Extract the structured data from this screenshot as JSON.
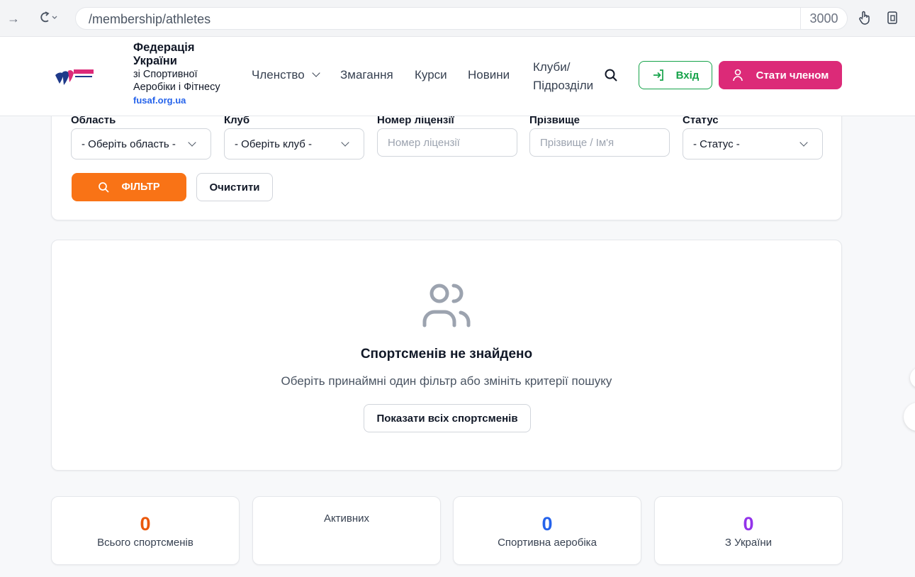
{
  "browser": {
    "url": "/membership/athletes",
    "port": "3000"
  },
  "header": {
    "brand_title": "Федерація України",
    "brand_sub": "зі Спортивної Аеробіки і Фітнесу",
    "brand_url": "fusaf.org.ua",
    "nav": {
      "membership": "Членство",
      "competitions": "Змагання",
      "courses": "Курси",
      "news": "Новини",
      "clubs_line1": "Клуби/",
      "clubs_line2": "Підрозділи"
    },
    "login_label": "Вхід",
    "join_label": "Стати членом"
  },
  "filters": {
    "region_label": "Область",
    "region_value": "- Оберіть область -",
    "club_label": "Клуб",
    "club_value": "- Оберіть клуб -",
    "license_label": "Номер ліцензії",
    "license_placeholder": "Номер ліцензії",
    "surname_label": "Прізвище",
    "surname_placeholder": "Прізвище / Ім'я",
    "status_label": "Статус",
    "status_value": "- Статус -",
    "filter_button": "ФІЛЬТР",
    "clear_button": "Очистити"
  },
  "empty_state": {
    "title": "Спортсменів не знайдено",
    "description": "Оберіть принаймні один фільтр або змініть критерії пошуку",
    "show_all_button": "Показати всіх спортсменів"
  },
  "stats": {
    "total": {
      "value": "0",
      "label": "Всього спортсменів",
      "color": "#ea580c"
    },
    "active": {
      "label": "Активних"
    },
    "aerobics": {
      "value": "0",
      "label": "Спортивна аеробіка",
      "color": "#2563eb"
    },
    "ukraine": {
      "value": "0",
      "label": "З України",
      "color": "#9333ea"
    }
  },
  "colors": {
    "brand_pink": "#dc2a78",
    "login_green": "#16a34a",
    "filter_orange": "#f97316"
  }
}
